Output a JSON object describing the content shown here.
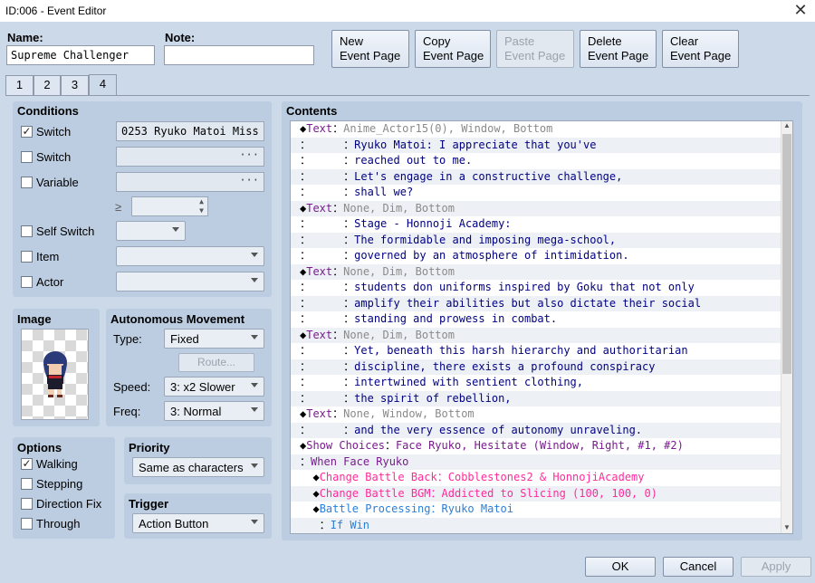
{
  "window": {
    "title": "ID:006 - Event Editor",
    "close": "✕"
  },
  "header": {
    "name_label": "Name:",
    "name_value": "Supreme Challenger",
    "note_label": "Note:",
    "note_value": ""
  },
  "toolbar": {
    "new": "New\nEvent Page",
    "copy": "Copy\nEvent Page",
    "paste": "Paste\nEvent Page",
    "delete": "Delete\nEvent Page",
    "clear": "Clear\nEvent Page"
  },
  "tabs": [
    "1",
    "2",
    "3",
    "4"
  ],
  "active_tab": "4",
  "conditions": {
    "title": "Conditions",
    "switch1_label": "Switch",
    "switch1_checked": true,
    "switch1_value": "0253 Ryuko Matoi Miss",
    "switch2_label": "Switch",
    "switch2_value": "",
    "variable_label": "Variable",
    "variable_value": "",
    "ge": "≥",
    "var_amount": "",
    "self_switch_label": "Self Switch",
    "item_label": "Item",
    "actor_label": "Actor",
    "ellipsis": "···"
  },
  "image": {
    "title": "Image"
  },
  "movement": {
    "title": "Autonomous Movement",
    "type_label": "Type:",
    "type_value": "Fixed",
    "route": "Route...",
    "speed_label": "Speed:",
    "speed_value": "3: x2 Slower",
    "freq_label": "Freq:",
    "freq_value": "3: Normal"
  },
  "options": {
    "title": "Options",
    "walking": "Walking",
    "stepping": "Stepping",
    "direction_fix": "Direction Fix",
    "through": "Through",
    "walking_checked": true
  },
  "priority": {
    "title": "Priority",
    "value": "Same as characters"
  },
  "trigger": {
    "title": "Trigger",
    "value": "Action Button"
  },
  "contents": {
    "title": "Contents",
    "lines": [
      {
        "p": "◆",
        "k": "Text",
        "s": "：",
        "r": "Anime_Actor15(0), Window, Bottom",
        "t": "text"
      },
      {
        "p": "：",
        "k": "",
        "s": "     ：",
        "r": "Ryuko Matoi: I appreciate that you've",
        "t": "body"
      },
      {
        "p": "：",
        "k": "",
        "s": "     ：",
        "r": "reached out to me.",
        "t": "body"
      },
      {
        "p": "：",
        "k": "",
        "s": "     ：",
        "r": "Let's engage in a constructive challenge,",
        "t": "body"
      },
      {
        "p": "：",
        "k": "",
        "s": "     ：",
        "r": "shall we?",
        "t": "body"
      },
      {
        "p": "◆",
        "k": "Text",
        "s": "：",
        "r": "None, Dim, Bottom",
        "t": "text"
      },
      {
        "p": "：",
        "k": "",
        "s": "     ：",
        "r": "Stage - Honnoji Academy:",
        "t": "body"
      },
      {
        "p": "：",
        "k": "",
        "s": "     ：",
        "r": "The formidable and imposing mega-school,",
        "t": "body"
      },
      {
        "p": "：",
        "k": "",
        "s": "     ：",
        "r": "governed by an atmosphere of intimidation.",
        "t": "body"
      },
      {
        "p": "◆",
        "k": "Text",
        "s": "：",
        "r": "None, Dim, Bottom",
        "t": "text"
      },
      {
        "p": "：",
        "k": "",
        "s": "     ：",
        "r": "students don uniforms inspired by Goku that not only",
        "t": "body"
      },
      {
        "p": "：",
        "k": "",
        "s": "     ：",
        "r": "amplify their abilities but also dictate their social",
        "t": "body"
      },
      {
        "p": "：",
        "k": "",
        "s": "     ：",
        "r": "standing and prowess in combat.",
        "t": "body"
      },
      {
        "p": "◆",
        "k": "Text",
        "s": "：",
        "r": "None, Dim, Bottom",
        "t": "text"
      },
      {
        "p": "：",
        "k": "",
        "s": "     ：",
        "r": "Yet, beneath this harsh hierarchy and authoritarian",
        "t": "body"
      },
      {
        "p": "：",
        "k": "",
        "s": "     ：",
        "r": "discipline, there exists a profound conspiracy",
        "t": "body"
      },
      {
        "p": "：",
        "k": "",
        "s": "     ：",
        "r": "intertwined with sentient clothing,",
        "t": "body"
      },
      {
        "p": "：",
        "k": "",
        "s": "     ：",
        "r": "the spirit of rebellion,",
        "t": "body"
      },
      {
        "p": "◆",
        "k": "Text",
        "s": "：",
        "r": "None, Window, Bottom",
        "t": "text"
      },
      {
        "p": "：",
        "k": "",
        "s": "     ：",
        "r": "and the very essence of autonomy unraveling.",
        "t": "body"
      },
      {
        "p": "◆",
        "k": "Show Choices",
        "s": "：",
        "r": "Face Ryuko, Hesitate (Window, Right, #1, #2)",
        "t": "choice"
      },
      {
        "p": "：",
        "k": "When Face Ryuko",
        "s": "",
        "r": "",
        "t": "when"
      },
      {
        "p": "  ◆",
        "k": "Change Battle Back",
        "s": "：",
        "r": "Cobblestones2 & HonnojiAcademy",
        "t": "pink"
      },
      {
        "p": "  ◆",
        "k": "Change Battle BGM",
        "s": "：",
        "r": "Addicted to Slicing (100, 100, 0)",
        "t": "pink"
      },
      {
        "p": "  ◆",
        "k": "Battle Processing",
        "s": "：",
        "r": "Ryuko Matoi",
        "t": "blue"
      },
      {
        "p": "   ：",
        "k": "If Win",
        "s": "",
        "r": "",
        "t": "blue2"
      }
    ]
  },
  "footer": {
    "ok": "OK",
    "cancel": "Cancel",
    "apply": "Apply"
  },
  "colors": {
    "text_cmd": "#7a1a8f",
    "gray": "#8a8a8a",
    "body": "#000080",
    "pink": "#ff2a9a",
    "blue": "#2a7fd8"
  }
}
